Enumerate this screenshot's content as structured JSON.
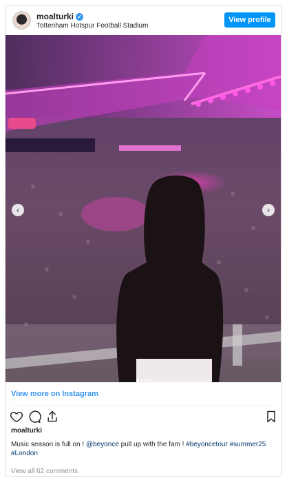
{
  "header": {
    "username": "moalturki",
    "location": "Tottenham Hotspur Football Stadium",
    "view_profile": "View profile"
  },
  "media": {
    "image_desc": "concert-crowd-photo",
    "slides_total": 4,
    "active_slide": 1
  },
  "view_more": "View more on Instagram",
  "post": {
    "username": "moalturki",
    "caption_text": "Music season is full on ! ",
    "caption_mention": "@beyonce",
    "caption_mid": " pull up with the fam ! ",
    "caption_tags": "#beyoncetour #summer25 #London",
    "comments": "View all 62 comments"
  },
  "colors": {
    "accent": "#0095f6",
    "link": "#3897f0",
    "stage_pink": "#ff2bd6"
  }
}
